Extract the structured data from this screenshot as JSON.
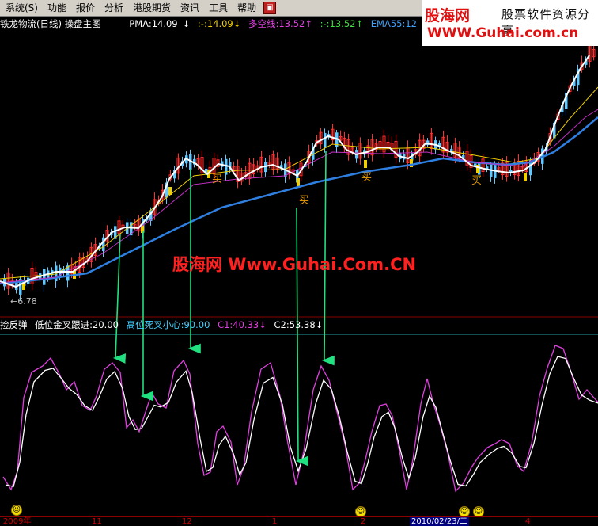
{
  "menu": {
    "items": [
      {
        "name": "menu-system",
        "label": "系统(S)"
      },
      {
        "name": "menu-function",
        "label": "功能"
      },
      {
        "name": "menu-quote",
        "label": "报价"
      },
      {
        "name": "menu-analysis",
        "label": "分析"
      },
      {
        "name": "menu-hk-futures",
        "label": "港股期货"
      },
      {
        "name": "menu-info",
        "label": "资讯"
      },
      {
        "name": "menu-tools",
        "label": "工具"
      },
      {
        "name": "menu-help",
        "label": "帮助"
      }
    ]
  },
  "logo": {
    "brand": "股海网",
    "slogan": "股票软件资源分享",
    "url": "WWW.Guhai.com.cn"
  },
  "main_header": {
    "title": "铁龙物流(日线) 操盘主图",
    "pma": "PMA:14.09",
    "dash1": ":-",
    "val1": ":14.09",
    "duokong": "多空线:13.52",
    "dash2": ":-",
    "val2": ":13.52",
    "ema": "EMA55:12"
  },
  "sub_header": {
    "name": "捡反弹",
    "low_gold": "低位金叉跟进:20.00",
    "high_dead": "高位死叉小心:90.00",
    "c1": "C1:40.33",
    "c2": "C2:53.38"
  },
  "chart": {
    "watermark": "股海网 Www.Guhai.Com.CN",
    "price_label": "←6.78",
    "buy_label": "买",
    "colors": {
      "up": "#ff3030",
      "down": "#60c8ff",
      "white": "#ffffff",
      "yellow": "#f0d000",
      "magenta": "#c030c0",
      "blue": "#2f7fe0",
      "arrow": "#20e080"
    }
  },
  "date_axis": {
    "labels": [
      "2009年",
      "11",
      "12",
      "1",
      "2",
      "3",
      "4"
    ],
    "cursor": "2010/02/23/二"
  }
}
